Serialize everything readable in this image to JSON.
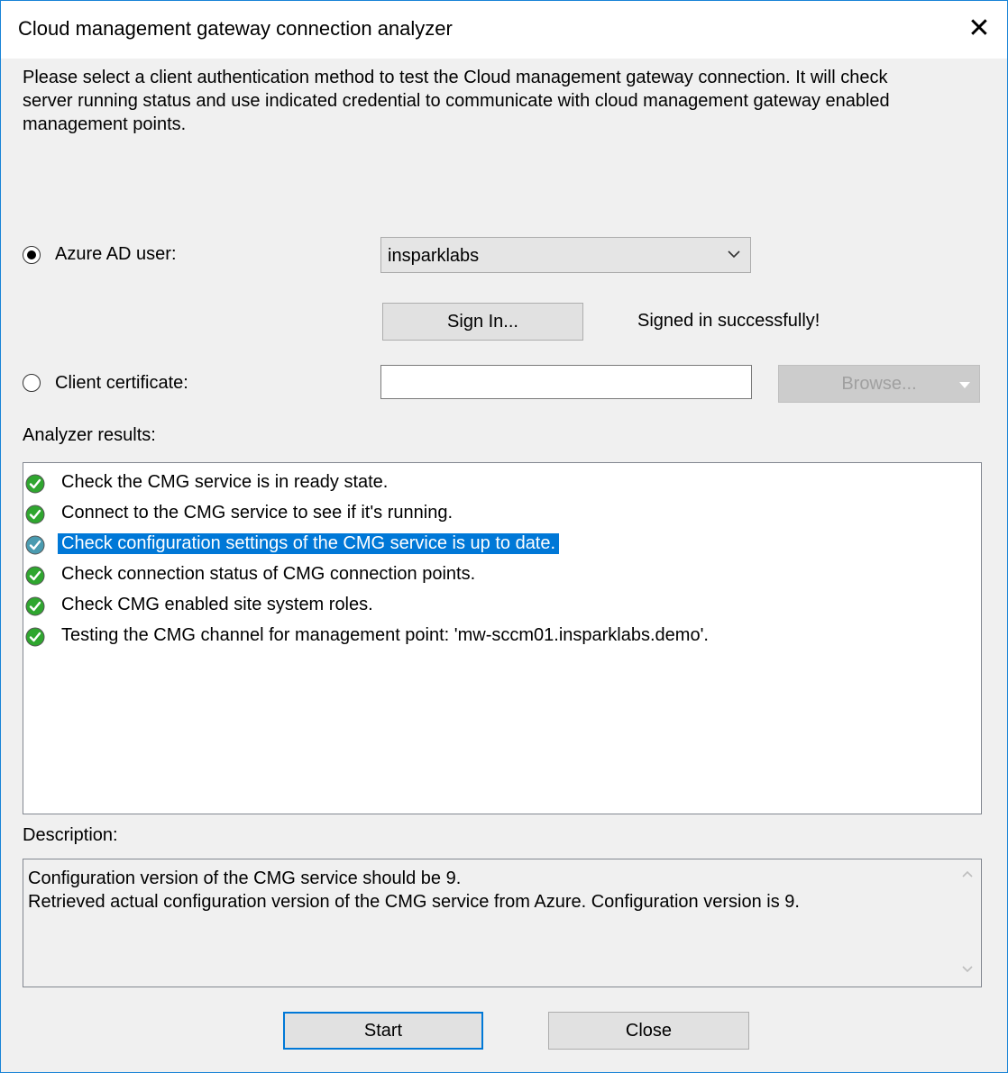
{
  "window": {
    "title": "Cloud management gateway connection analyzer",
    "close_glyph": "✕"
  },
  "intro_lines": [
    "Please select a client authentication method to test the Cloud management gateway connection. It will check",
    "server running status and use indicated credential to communicate with cloud management gateway enabled",
    "management points."
  ],
  "auth": {
    "azure_ad_label": "Azure AD user:",
    "azure_ad_selected": true,
    "user_select_value": "insparklabs",
    "user_select_icon": "chevron-down-icon",
    "sign_in_label": "Sign In...",
    "sign_in_status": "Signed in successfully!",
    "client_cert_label": "Client certificate:",
    "client_cert_selected": false,
    "client_cert_value": "",
    "browse_label": "Browse..."
  },
  "results": {
    "label": "Analyzer results:",
    "items": [
      {
        "text": "Check the CMG service is in ready state.",
        "status": "success",
        "selected": false
      },
      {
        "text": "Connect to the CMG service to see if it's running.",
        "status": "success",
        "selected": false
      },
      {
        "text": "Check configuration settings of the CMG service is up to date.",
        "status": "success",
        "selected": true
      },
      {
        "text": "Check connection status of CMG connection points.",
        "status": "success",
        "selected": false
      },
      {
        "text": "Check CMG enabled site system roles.",
        "status": "success",
        "selected": false
      },
      {
        "text": "Testing the CMG channel for management point: 'mw-sccm01.insparklabs.demo'.",
        "status": "success",
        "selected": false
      }
    ],
    "success_color": "#2fa62f",
    "selected_color": "#0078d7"
  },
  "description": {
    "label": "Description:",
    "lines": [
      "Configuration version of the CMG service should be 9.",
      "Retrieved actual configuration version of the CMG service from Azure. Configuration version is 9."
    ]
  },
  "buttons": {
    "start_label": "Start",
    "close_label": "Close"
  }
}
